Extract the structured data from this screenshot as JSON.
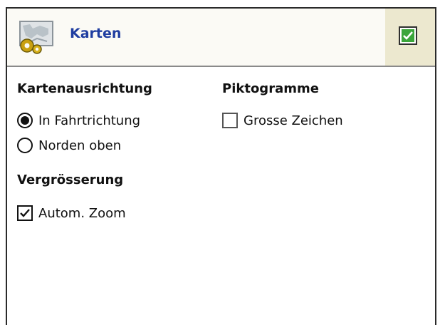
{
  "title_bar": {
    "title": "Karten",
    "icon": "map-settings-icon",
    "ok_icon": "ok-check-icon",
    "title_color": "#1f3da0"
  },
  "map_orientation": {
    "heading": "Kartenausrichtung",
    "options": [
      {
        "label": "In Fahrtrichtung",
        "selected": true
      },
      {
        "label": "Norden oben",
        "selected": false
      }
    ]
  },
  "magnification": {
    "heading": "Vergrösserung",
    "auto_zoom": {
      "label": "Autom. Zoom",
      "checked": true
    }
  },
  "pictograms": {
    "heading": "Piktogramme",
    "large_icons": {
      "label": "Grosse Zeichen",
      "checked": false
    }
  }
}
